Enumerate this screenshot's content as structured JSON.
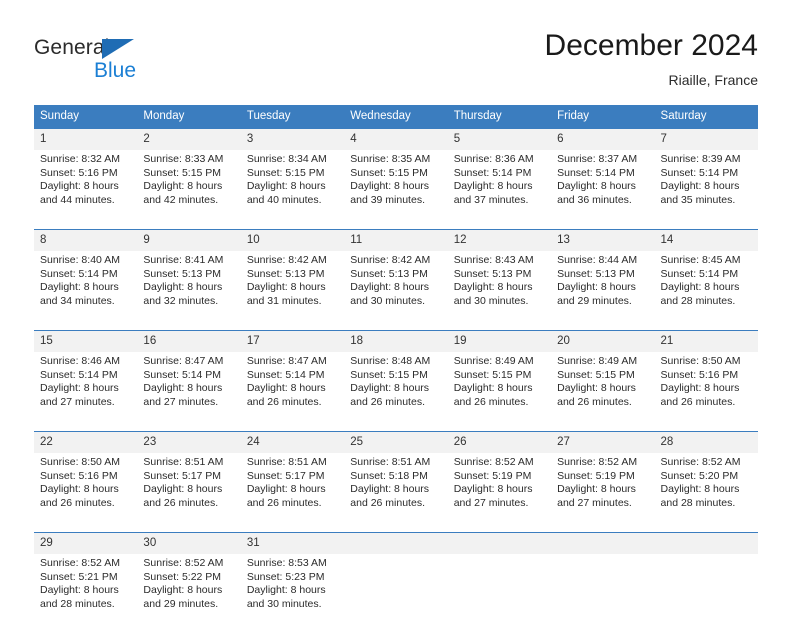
{
  "brand": {
    "name_part1": "General",
    "name_part2": "Blue",
    "flag_icon": "triangle-flag-icon",
    "colors": {
      "general_text": "#2b2b2b",
      "blue_text": "#1b7fd4",
      "flag": "#1f6cb4"
    }
  },
  "header": {
    "title": "December 2024",
    "subtitle": "Riaille, France"
  },
  "calendar": {
    "header_bg": "#3b7dbf",
    "daynum_bg": "#f2f2f2",
    "weekdays": [
      "Sunday",
      "Monday",
      "Tuesday",
      "Wednesday",
      "Thursday",
      "Friday",
      "Saturday"
    ],
    "weeks": [
      {
        "days": [
          {
            "num": "1",
            "sunrise": "Sunrise: 8:32 AM",
            "sunset": "Sunset: 5:16 PM",
            "daylight1": "Daylight: 8 hours",
            "daylight2": "and 44 minutes."
          },
          {
            "num": "2",
            "sunrise": "Sunrise: 8:33 AM",
            "sunset": "Sunset: 5:15 PM",
            "daylight1": "Daylight: 8 hours",
            "daylight2": "and 42 minutes."
          },
          {
            "num": "3",
            "sunrise": "Sunrise: 8:34 AM",
            "sunset": "Sunset: 5:15 PM",
            "daylight1": "Daylight: 8 hours",
            "daylight2": "and 40 minutes."
          },
          {
            "num": "4",
            "sunrise": "Sunrise: 8:35 AM",
            "sunset": "Sunset: 5:15 PM",
            "daylight1": "Daylight: 8 hours",
            "daylight2": "and 39 minutes."
          },
          {
            "num": "5",
            "sunrise": "Sunrise: 8:36 AM",
            "sunset": "Sunset: 5:14 PM",
            "daylight1": "Daylight: 8 hours",
            "daylight2": "and 37 minutes."
          },
          {
            "num": "6",
            "sunrise": "Sunrise: 8:37 AM",
            "sunset": "Sunset: 5:14 PM",
            "daylight1": "Daylight: 8 hours",
            "daylight2": "and 36 minutes."
          },
          {
            "num": "7",
            "sunrise": "Sunrise: 8:39 AM",
            "sunset": "Sunset: 5:14 PM",
            "daylight1": "Daylight: 8 hours",
            "daylight2": "and 35 minutes."
          }
        ]
      },
      {
        "days": [
          {
            "num": "8",
            "sunrise": "Sunrise: 8:40 AM",
            "sunset": "Sunset: 5:14 PM",
            "daylight1": "Daylight: 8 hours",
            "daylight2": "and 34 minutes."
          },
          {
            "num": "9",
            "sunrise": "Sunrise: 8:41 AM",
            "sunset": "Sunset: 5:13 PM",
            "daylight1": "Daylight: 8 hours",
            "daylight2": "and 32 minutes."
          },
          {
            "num": "10",
            "sunrise": "Sunrise: 8:42 AM",
            "sunset": "Sunset: 5:13 PM",
            "daylight1": "Daylight: 8 hours",
            "daylight2": "and 31 minutes."
          },
          {
            "num": "11",
            "sunrise": "Sunrise: 8:42 AM",
            "sunset": "Sunset: 5:13 PM",
            "daylight1": "Daylight: 8 hours",
            "daylight2": "and 30 minutes."
          },
          {
            "num": "12",
            "sunrise": "Sunrise: 8:43 AM",
            "sunset": "Sunset: 5:13 PM",
            "daylight1": "Daylight: 8 hours",
            "daylight2": "and 30 minutes."
          },
          {
            "num": "13",
            "sunrise": "Sunrise: 8:44 AM",
            "sunset": "Sunset: 5:13 PM",
            "daylight1": "Daylight: 8 hours",
            "daylight2": "and 29 minutes."
          },
          {
            "num": "14",
            "sunrise": "Sunrise: 8:45 AM",
            "sunset": "Sunset: 5:14 PM",
            "daylight1": "Daylight: 8 hours",
            "daylight2": "and 28 minutes."
          }
        ]
      },
      {
        "days": [
          {
            "num": "15",
            "sunrise": "Sunrise: 8:46 AM",
            "sunset": "Sunset: 5:14 PM",
            "daylight1": "Daylight: 8 hours",
            "daylight2": "and 27 minutes."
          },
          {
            "num": "16",
            "sunrise": "Sunrise: 8:47 AM",
            "sunset": "Sunset: 5:14 PM",
            "daylight1": "Daylight: 8 hours",
            "daylight2": "and 27 minutes."
          },
          {
            "num": "17",
            "sunrise": "Sunrise: 8:47 AM",
            "sunset": "Sunset: 5:14 PM",
            "daylight1": "Daylight: 8 hours",
            "daylight2": "and 26 minutes."
          },
          {
            "num": "18",
            "sunrise": "Sunrise: 8:48 AM",
            "sunset": "Sunset: 5:15 PM",
            "daylight1": "Daylight: 8 hours",
            "daylight2": "and 26 minutes."
          },
          {
            "num": "19",
            "sunrise": "Sunrise: 8:49 AM",
            "sunset": "Sunset: 5:15 PM",
            "daylight1": "Daylight: 8 hours",
            "daylight2": "and 26 minutes."
          },
          {
            "num": "20",
            "sunrise": "Sunrise: 8:49 AM",
            "sunset": "Sunset: 5:15 PM",
            "daylight1": "Daylight: 8 hours",
            "daylight2": "and 26 minutes."
          },
          {
            "num": "21",
            "sunrise": "Sunrise: 8:50 AM",
            "sunset": "Sunset: 5:16 PM",
            "daylight1": "Daylight: 8 hours",
            "daylight2": "and 26 minutes."
          }
        ]
      },
      {
        "days": [
          {
            "num": "22",
            "sunrise": "Sunrise: 8:50 AM",
            "sunset": "Sunset: 5:16 PM",
            "daylight1": "Daylight: 8 hours",
            "daylight2": "and 26 minutes."
          },
          {
            "num": "23",
            "sunrise": "Sunrise: 8:51 AM",
            "sunset": "Sunset: 5:17 PM",
            "daylight1": "Daylight: 8 hours",
            "daylight2": "and 26 minutes."
          },
          {
            "num": "24",
            "sunrise": "Sunrise: 8:51 AM",
            "sunset": "Sunset: 5:17 PM",
            "daylight1": "Daylight: 8 hours",
            "daylight2": "and 26 minutes."
          },
          {
            "num": "25",
            "sunrise": "Sunrise: 8:51 AM",
            "sunset": "Sunset: 5:18 PM",
            "daylight1": "Daylight: 8 hours",
            "daylight2": "and 26 minutes."
          },
          {
            "num": "26",
            "sunrise": "Sunrise: 8:52 AM",
            "sunset": "Sunset: 5:19 PM",
            "daylight1": "Daylight: 8 hours",
            "daylight2": "and 27 minutes."
          },
          {
            "num": "27",
            "sunrise": "Sunrise: 8:52 AM",
            "sunset": "Sunset: 5:19 PM",
            "daylight1": "Daylight: 8 hours",
            "daylight2": "and 27 minutes."
          },
          {
            "num": "28",
            "sunrise": "Sunrise: 8:52 AM",
            "sunset": "Sunset: 5:20 PM",
            "daylight1": "Daylight: 8 hours",
            "daylight2": "and 28 minutes."
          }
        ]
      },
      {
        "days": [
          {
            "num": "29",
            "sunrise": "Sunrise: 8:52 AM",
            "sunset": "Sunset: 5:21 PM",
            "daylight1": "Daylight: 8 hours",
            "daylight2": "and 28 minutes."
          },
          {
            "num": "30",
            "sunrise": "Sunrise: 8:52 AM",
            "sunset": "Sunset: 5:22 PM",
            "daylight1": "Daylight: 8 hours",
            "daylight2": "and 29 minutes."
          },
          {
            "num": "31",
            "sunrise": "Sunrise: 8:53 AM",
            "sunset": "Sunset: 5:23 PM",
            "daylight1": "Daylight: 8 hours",
            "daylight2": "and 30 minutes."
          },
          {
            "num": "",
            "sunrise": "",
            "sunset": "",
            "daylight1": "",
            "daylight2": ""
          },
          {
            "num": "",
            "sunrise": "",
            "sunset": "",
            "daylight1": "",
            "daylight2": ""
          },
          {
            "num": "",
            "sunrise": "",
            "sunset": "",
            "daylight1": "",
            "daylight2": ""
          },
          {
            "num": "",
            "sunrise": "",
            "sunset": "",
            "daylight1": "",
            "daylight2": ""
          }
        ]
      }
    ]
  }
}
